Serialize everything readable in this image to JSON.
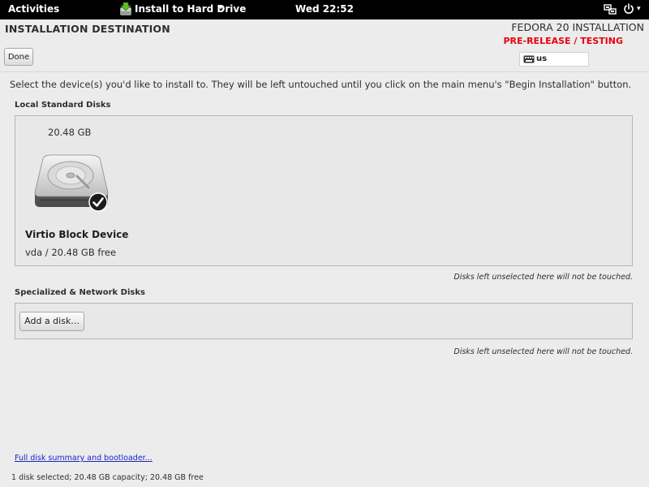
{
  "topbar": {
    "activities": "Activities",
    "app_name": "Install to Hard Drive",
    "app_menu_arrow": "▾",
    "clock": "Wed 22:52",
    "power_menu_arrow": "▾",
    "icons": [
      "installer-app-icon",
      "network-icon",
      "power-icon"
    ]
  },
  "header": {
    "title": "INSTALLATION DESTINATION",
    "done_label": "Done",
    "product": "FEDORA 20 INSTALLATION",
    "prerelease": "PRE-RELEASE / TESTING",
    "keyboard_layout": "us"
  },
  "intro": "Select the device(s) you'd like to install to.  They will be left untouched until you click on the main menu's \"Begin Installation\" button.",
  "local_disks": {
    "label": "Local Standard Disks",
    "disks": [
      {
        "size": "20.48 GB",
        "name": "Virtio Block Device",
        "detail": "vda  /  20.48 GB free",
        "selected": true
      }
    ],
    "note": "Disks left unselected here will not be touched."
  },
  "specialized_disks": {
    "label": "Specialized & Network Disks",
    "add_label": "Add a disk...",
    "note": "Disks left unselected here will not be touched."
  },
  "footer": {
    "summary_link": "Full disk summary and bootloader...",
    "status": "1 disk selected; 20.48 GB capacity; 20.48 GB free"
  },
  "colors": {
    "prerelease": "#e8000e",
    "link": "#1a22c8",
    "topbar": "#000000",
    "background": "#ececec"
  }
}
